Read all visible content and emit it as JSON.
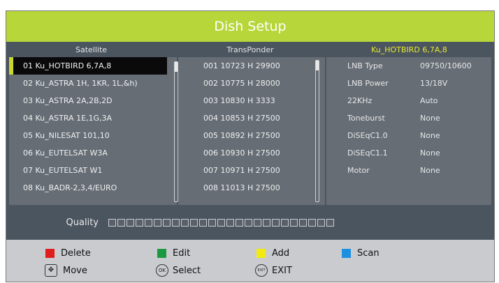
{
  "title": "Dish Setup",
  "headers": {
    "satellite": "Satellite",
    "transponder": "TransPonder",
    "selected": "Ku_HOTBIRD 6,7A,8"
  },
  "satellites": [
    "01 Ku_HOTBIRD 6,7A,8",
    "02 Ku_ASTRA 1H, 1KR, 1L,&h)",
    "03 Ku_ASTRA 2A,2B,2D",
    "04 Ku_ASTRA 1E,1G,3A",
    "05 Ku_NILESAT 101,10",
    "06 Ku_EUTELSAT W3A",
    "07 Ku_EUTELSAT W1",
    "08 Ku_BADR-2,3,4/EURO"
  ],
  "transponders": [
    "001 10723 H 29900",
    "002 10775 H 28000",
    "003 10830 H 3333",
    "004 10853 H 27500",
    "005 10892 H 27500",
    "006 10930 H 27500",
    "007 10971 H 27500",
    "008 11013 H 27500"
  ],
  "properties": [
    {
      "label": "LNB Type",
      "value": "09750/10600"
    },
    {
      "label": "LNB Power",
      "value": "13/18V"
    },
    {
      "label": "22KHz",
      "value": "Auto"
    },
    {
      "label": "Toneburst",
      "value": "None"
    },
    {
      "label": "DiSEqC1.0",
      "value": "None"
    },
    {
      "label": "DiSEqC1.1",
      "value": "None"
    },
    {
      "label": "Motor",
      "value": "None"
    }
  ],
  "quality": {
    "label": "Quality",
    "segments": 25,
    "level": 0
  },
  "legend": {
    "delete": "Delete",
    "edit": "Edit",
    "add": "Add",
    "scan": "Scan",
    "move": "Move",
    "select": "Select",
    "exit": "EXIT",
    "ok_glyph": "OK",
    "exit_glyph": "EXIT"
  },
  "colors": {
    "delete": "#e01e1e",
    "edit": "#1a9a3e",
    "add": "#f3ea12",
    "scan": "#1e90e0",
    "title_bar": "#b7d63a",
    "selected_header": "#e9ea2b"
  }
}
